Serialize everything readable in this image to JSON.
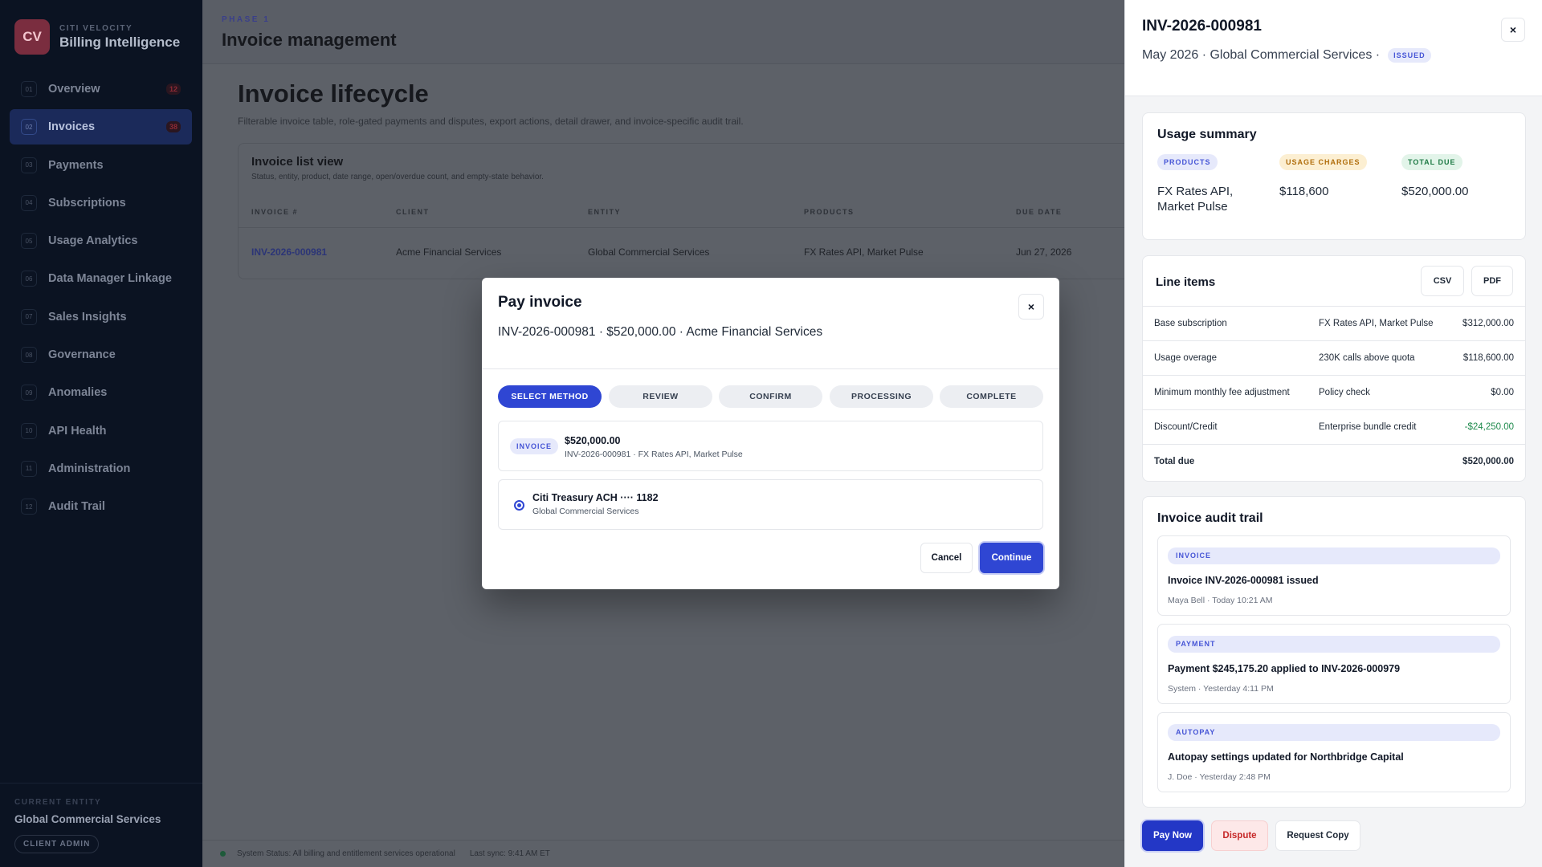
{
  "sidebar": {
    "logo": "CV",
    "kicker": "CITI VELOCITY",
    "app_name": "Billing Intelligence",
    "items": [
      {
        "num": "01",
        "label": "Overview",
        "badge": "12"
      },
      {
        "num": "02",
        "label": "Invoices",
        "badge": "38"
      },
      {
        "num": "03",
        "label": "Payments"
      },
      {
        "num": "04",
        "label": "Subscriptions"
      },
      {
        "num": "05",
        "label": "Usage Analytics"
      },
      {
        "num": "06",
        "label": "Data Manager Linkage"
      },
      {
        "num": "07",
        "label": "Sales Insights"
      },
      {
        "num": "08",
        "label": "Governance"
      },
      {
        "num": "09",
        "label": "Anomalies"
      },
      {
        "num": "10",
        "label": "API Health"
      },
      {
        "num": "11",
        "label": "Administration"
      },
      {
        "num": "12",
        "label": "Audit Trail"
      }
    ],
    "current_entity_label": "CURRENT ENTITY",
    "current_entity": "Global Commercial Services",
    "role": "CLIENT ADMIN"
  },
  "header": {
    "phase": "PHASE 1",
    "title": "Invoice management"
  },
  "main": {
    "section_title": "Invoice lifecycle",
    "section_sub": "Filterable invoice table, role-gated payments and disputes, export actions, detail drawer, and invoice-specific audit trail.",
    "list_title": "Invoice list view",
    "list_sub": "Status, entity, product, date range, open/overdue count, and empty-state behavior.",
    "columns": [
      "INVOICE #",
      "CLIENT",
      "ENTITY",
      "PRODUCTS",
      "DUE DATE"
    ],
    "rows": [
      {
        "invoice": "INV-2026-000981",
        "client": "Acme Financial Services",
        "entity": "Global Commercial Services",
        "products": "FX Rates API, Market Pulse",
        "due": "Jun 27, 2026"
      }
    ]
  },
  "status": {
    "text": "System Status: All billing and entitlement services operational",
    "sync": "Last sync: 9:41 AM ET"
  },
  "drawer": {
    "title": "INV-2026-000981",
    "subtitle": "May 2026 · Global Commercial Services ·",
    "status": "ISSUED",
    "close": "×",
    "usage": {
      "title": "Usage summary",
      "products_label": "PRODUCTS",
      "products_value": "FX Rates API, Market Pulse",
      "charges_label": "USAGE CHARGES",
      "charges_value": "$118,600",
      "due_label": "TOTAL DUE",
      "due_value": "$520,000.00"
    },
    "line_items": {
      "title": "Line items",
      "csv": "CSV",
      "pdf": "PDF",
      "rows": [
        {
          "name": "Base subscription",
          "detail": "FX Rates API, Market Pulse",
          "amount": "$312,000.00"
        },
        {
          "name": "Usage overage",
          "detail": "230K calls above quota",
          "amount": "$118,600.00"
        },
        {
          "name": "Minimum monthly fee adjustment",
          "detail": "Policy check",
          "amount": "$0.00"
        },
        {
          "name": "Discount/Credit",
          "detail": "Enterprise bundle credit",
          "amount": "-$24,250.00"
        }
      ],
      "total_label": "Total due",
      "total_value": "$520,000.00"
    },
    "audit": {
      "title": "Invoice audit trail",
      "items": [
        {
          "tag": "INVOICE",
          "text": "Invoice INV-2026-000981 issued",
          "meta": "Maya Bell · Today 10:21 AM"
        },
        {
          "tag": "PAYMENT",
          "text": "Payment $245,175.20 applied to INV-2026-000979",
          "meta": "System · Yesterday 4:11 PM"
        },
        {
          "tag": "AUTOPAY",
          "text": "Autopay settings updated for Northbridge Capital",
          "meta": "J. Doe · Yesterday 2:48 PM"
        }
      ]
    },
    "actions": {
      "pay": "Pay Now",
      "dispute": "Dispute",
      "copy": "Request Copy"
    }
  },
  "modal": {
    "title": "Pay invoice",
    "subtitle": "INV-2026-000981 · $520,000.00 · Acme Financial Services",
    "close": "×",
    "steps": [
      "SELECT METHOD",
      "REVIEW",
      "CONFIRM",
      "PROCESSING",
      "COMPLETE"
    ],
    "invoice_chip": "INVOICE",
    "invoice_amount": "$520,000.00",
    "invoice_desc": "INV-2026-000981 · FX Rates API, Market Pulse",
    "method_name": "Citi Treasury ACH ···· 1182",
    "method_entity": "Global Commercial Services",
    "cancel": "Cancel",
    "continue": "Continue"
  },
  "colors": {
    "accent": "#2f46d3",
    "sidebar_bg": "#0b1322",
    "danger": "#c62828",
    "success": "#1e8a4c"
  }
}
